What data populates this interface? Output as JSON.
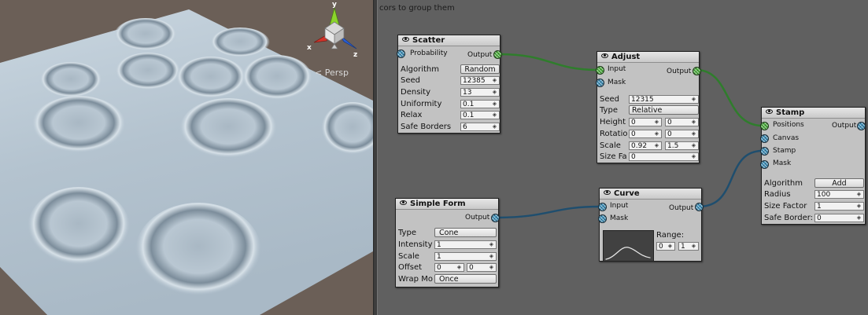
{
  "viewport": {
    "projection_label": "< Persp",
    "gizmo": {
      "axis_y": "y",
      "axis_x": "x",
      "axis_z": "z"
    }
  },
  "graph": {
    "hint": "cors to group them",
    "nodes": {
      "scatter": {
        "title": "Scatter",
        "in_port": "Probability",
        "out_port": "Output",
        "algorithm_label": "Algorithm",
        "algorithm_value": "Random",
        "fields": [
          {
            "label": "Seed",
            "value": "12385"
          },
          {
            "label": "Density",
            "value": "13"
          },
          {
            "label": "Uniformity",
            "value": "0.1"
          },
          {
            "label": "Relax",
            "value": "0.1"
          },
          {
            "label": "Safe Borders",
            "value": "6"
          }
        ]
      },
      "adjust": {
        "title": "Adjust",
        "in_port": "Input",
        "mask_port": "Mask",
        "out_port": "Output",
        "seed_label": "Seed",
        "seed_value": "12315",
        "type_label": "Type",
        "type_value": "Relative",
        "pairs": [
          {
            "label": "Height",
            "a": "0",
            "b": "0"
          },
          {
            "label": "Rotatio",
            "a": "0",
            "b": "0"
          },
          {
            "label": "Scale",
            "a": "0.92",
            "b": "1.5"
          }
        ],
        "sizefa_label": "Size Fa",
        "sizefa_value": "0"
      },
      "stamp": {
        "title": "Stamp",
        "ports": [
          "Positions",
          "Canvas",
          "Stamp",
          "Mask"
        ],
        "out_port": "Output",
        "algorithm_label": "Algorithm",
        "algorithm_value": "Add",
        "fields": [
          {
            "label": "Radius",
            "value": "100"
          },
          {
            "label": "Size Factor",
            "value": "1"
          },
          {
            "label": "Safe Border:",
            "value": "0"
          }
        ]
      },
      "simple_form": {
        "title": "Simple Form",
        "out_port": "Output",
        "type_label": "Type",
        "type_value": "Cone",
        "fields": [
          {
            "label": "Intensity",
            "value": "1"
          },
          {
            "label": "Scale",
            "value": "1"
          }
        ],
        "offset_label": "Offset",
        "offset_a": "0",
        "offset_b": "0",
        "wrap_label": "Wrap Mo",
        "wrap_value": "Once"
      },
      "curve": {
        "title": "Curve",
        "in_port": "Input",
        "mask_port": "Mask",
        "out_port": "Output",
        "range_label": "Range:",
        "range_a": "0",
        "range_b": "1"
      }
    },
    "colors": {
      "wire_green": "#2f7d2c",
      "wire_blue": "#1f4e6e"
    }
  }
}
